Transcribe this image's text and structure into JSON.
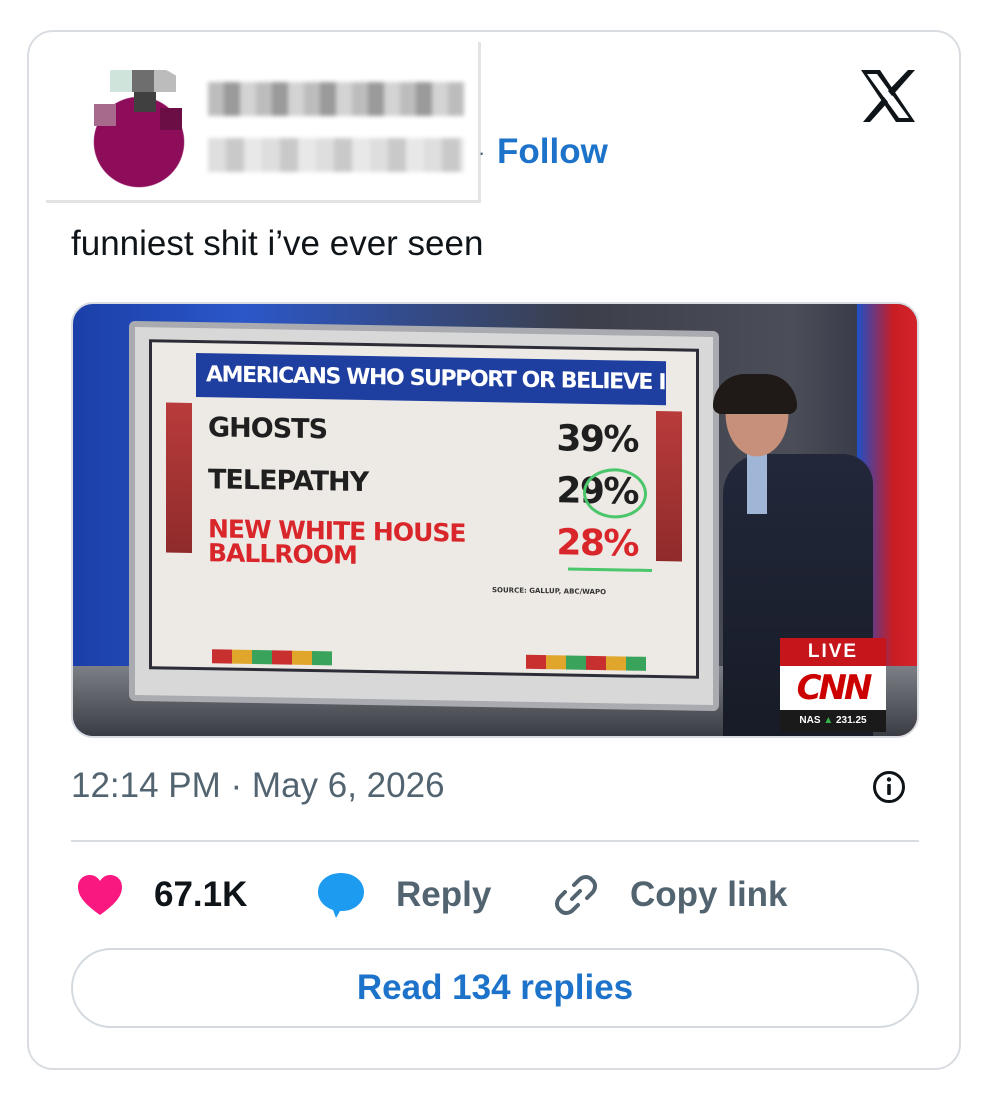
{
  "header": {
    "follow_label": "Follow",
    "separator": "·",
    "logo_icon": "x-logo-icon"
  },
  "tweet": {
    "text": "funniest shit i’ve ever seen",
    "timestamp": "12:14 PM · May 6, 2026"
  },
  "media": {
    "screen_title": "AMERICANS WHO SUPPORT OR BELIEVE IN...",
    "rows": [
      {
        "label": "GHOSTS",
        "value": "39%"
      },
      {
        "label": "TELEPATHY",
        "value": "29%"
      },
      {
        "label_line1": "NEW WHITE HOUSE",
        "label_line2": "BALLROOM",
        "value": "28%"
      }
    ],
    "source": "SOURCE: GALLUP, ABC/WAPO",
    "live_label": "LIVE",
    "network": "CNN",
    "ticker_symbol": "NAS",
    "ticker_value": "231.25"
  },
  "actions": {
    "like_count": "67.1K",
    "reply_label": "Reply",
    "copy_label": "Copy link",
    "read_replies_label": "Read 134 replies"
  },
  "colors": {
    "accent_blue": "#1d73c9",
    "like_pink": "#f91880",
    "reply_blue": "#1d9bf0",
    "muted_text": "#536471",
    "cnn_red": "#cc0000"
  }
}
